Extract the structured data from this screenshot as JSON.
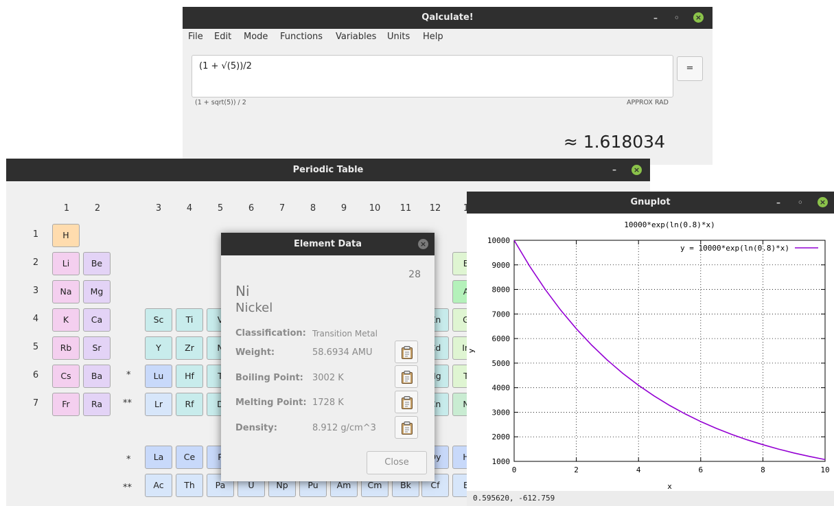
{
  "qalculate": {
    "title": "Qalculate!",
    "menu": [
      "File",
      "Edit",
      "Mode",
      "Functions",
      "Variables",
      "Units",
      "Help"
    ],
    "expression": "(1 + √(5))/2",
    "equals_label": "=",
    "parsed": "(1 + sqrt(5)) / 2",
    "modes": "APPROX  RAD",
    "result": "≈ 1.618034"
  },
  "periodic_table": {
    "title": "Periodic Table",
    "columns": [
      "1",
      "2",
      "3",
      "4",
      "5",
      "6",
      "7",
      "8",
      "9",
      "10",
      "11",
      "12",
      "1"
    ],
    "rows": [
      "1",
      "2",
      "3",
      "4",
      "5",
      "6",
      "7"
    ],
    "series_marks": [
      "*",
      "**",
      "*",
      "**"
    ],
    "elements": {
      "H": "H",
      "Li": "Li",
      "Be": "Be",
      "Na": "Na",
      "Mg": "Mg",
      "K": "K",
      "Ca": "Ca",
      "Rb": "Rb",
      "Sr": "Sr",
      "Cs": "Cs",
      "Ba": "Ba",
      "Fr": "Fr",
      "Ra": "Ra",
      "Sc": "Sc",
      "Ti": "Ti",
      "V": "V",
      "Y": "Y",
      "Zr": "Zr",
      "Nb": "N",
      "Lu": "Lu",
      "Hf": "Hf",
      "Ta": "T",
      "Lr": "Lr",
      "Rf": "Rf",
      "Db": "D",
      "Zn": "Zn",
      "Cd": "Cd",
      "Hg": "Hg",
      "Cn": "Cn",
      "B": "B",
      "Al": "A",
      "Ga": "G",
      "In": "In",
      "Tl": "T",
      "Nh": "N",
      "La": "La",
      "Ce": "Ce",
      "Pr": "P",
      "Dy": "Dy",
      "Ho": "H",
      "Ac": "Ac",
      "Th": "Th",
      "Pa": "Pa",
      "U": "U",
      "Np": "Np",
      "Pu": "Pu",
      "Am": "Am",
      "Cm": "Cm",
      "Bk": "Bk",
      "Cf": "Cf",
      "Es": "E"
    }
  },
  "element_data": {
    "title": "Element Data",
    "number": "28",
    "symbol": "Ni",
    "name": "Nickel",
    "classification_label": "Classification:",
    "classification": "Transition Metal",
    "weight_label": "Weight:",
    "weight": "58.6934 AMU",
    "boiling_label": "Boiling Point:",
    "boiling": "3002 K",
    "melting_label": "Melting Point:",
    "melting": "1728 K",
    "density_label": "Density:",
    "density": "8.912 g/cm^3",
    "close_label": "Close"
  },
  "gnuplot": {
    "title": "Gnuplot",
    "status": "0.595620, -612.759"
  },
  "chart_data": {
    "type": "line",
    "title": "10000*exp(ln(0.8)*x)",
    "xlabel": "x",
    "ylabel": "y",
    "xlim": [
      0,
      10
    ],
    "ylim": [
      1000,
      10000
    ],
    "xticks": [
      "0",
      "2",
      "4",
      "6",
      "8",
      "10"
    ],
    "yticks": [
      "1000",
      "2000",
      "3000",
      "4000",
      "5000",
      "6000",
      "7000",
      "8000",
      "9000",
      "10000"
    ],
    "grid": true,
    "legend_position": "top-right",
    "series": [
      {
        "name": "y =  10000*exp(ln(0.8)*x)",
        "color": "#9400d3",
        "x": [
          0,
          0.5,
          1,
          1.5,
          2,
          2.5,
          3,
          3.5,
          4,
          4.5,
          5,
          5.5,
          6,
          6.5,
          7,
          7.5,
          8,
          8.5,
          9,
          9.5,
          10
        ],
        "y": [
          10000,
          8944,
          8000,
          7155,
          6400,
          5724,
          5120,
          4579,
          4096,
          3664,
          3277,
          2931,
          2621,
          2345,
          2097,
          1876,
          1678,
          1501,
          1342,
          1201,
          1074
        ]
      }
    ]
  },
  "colors": {
    "titlebar": "#2f2f2f",
    "close_button": "#8bc34a",
    "plot_line": "#9400d3"
  }
}
